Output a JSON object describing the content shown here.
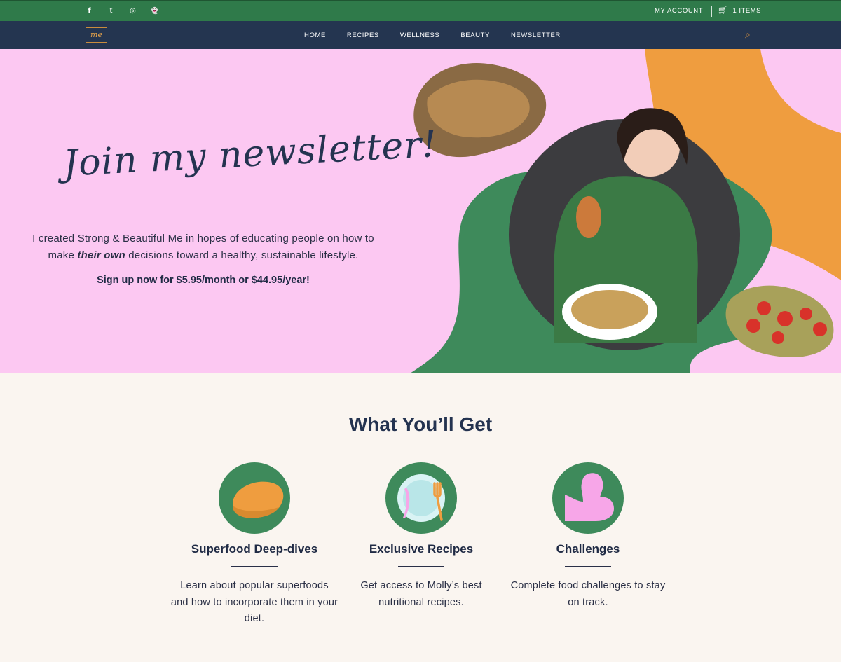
{
  "topbar": {
    "social": [
      {
        "icon": "facebook-icon",
        "glyph": "f"
      },
      {
        "icon": "twitter-icon",
        "glyph": "t"
      },
      {
        "icon": "instagram-icon",
        "glyph": "◎"
      },
      {
        "icon": "snapchat-icon",
        "glyph": "👻"
      }
    ],
    "account_label": "MY ACCOUNT",
    "cart_label": "1 ITEMS",
    "cart_icon": "shopping-cart-icon"
  },
  "nav": {
    "logo_text": "me",
    "items": [
      "HOME",
      "RECIPES",
      "WELLNESS",
      "BEAUTY",
      "NEWSLETTER"
    ],
    "search_icon": "search-icon"
  },
  "hero": {
    "title": "Join my newsletter!",
    "text_before": "I created Strong & Beautiful Me in hopes of educating people on how to make",
    "text_emphasis": "their own",
    "text_after": "decisions toward a healthy, sustainable lifestyle.",
    "cta": "Sign up now for $5.95/month or $44.95/year!"
  },
  "features": {
    "title": "What You’ll Get",
    "items": [
      {
        "icon": "sweet-potato-icon",
        "title": "Superfood Deep-dives",
        "desc": "Learn about popular superfoods and how to incorporate them in your diet."
      },
      {
        "icon": "plate-fork-knife-icon",
        "title": "Exclusive Recipes",
        "desc": "Get access to Molly’s best nutritional recipes."
      },
      {
        "icon": "flexed-arm-icon",
        "title": "Challenges",
        "desc": "Complete food challenges to stay on track."
      }
    ]
  },
  "colors": {
    "green": "#3e8a5b",
    "navy": "#243550",
    "pink": "#fcc8f2",
    "orange": "#ef9d3f",
    "cream": "#faf5f0"
  }
}
